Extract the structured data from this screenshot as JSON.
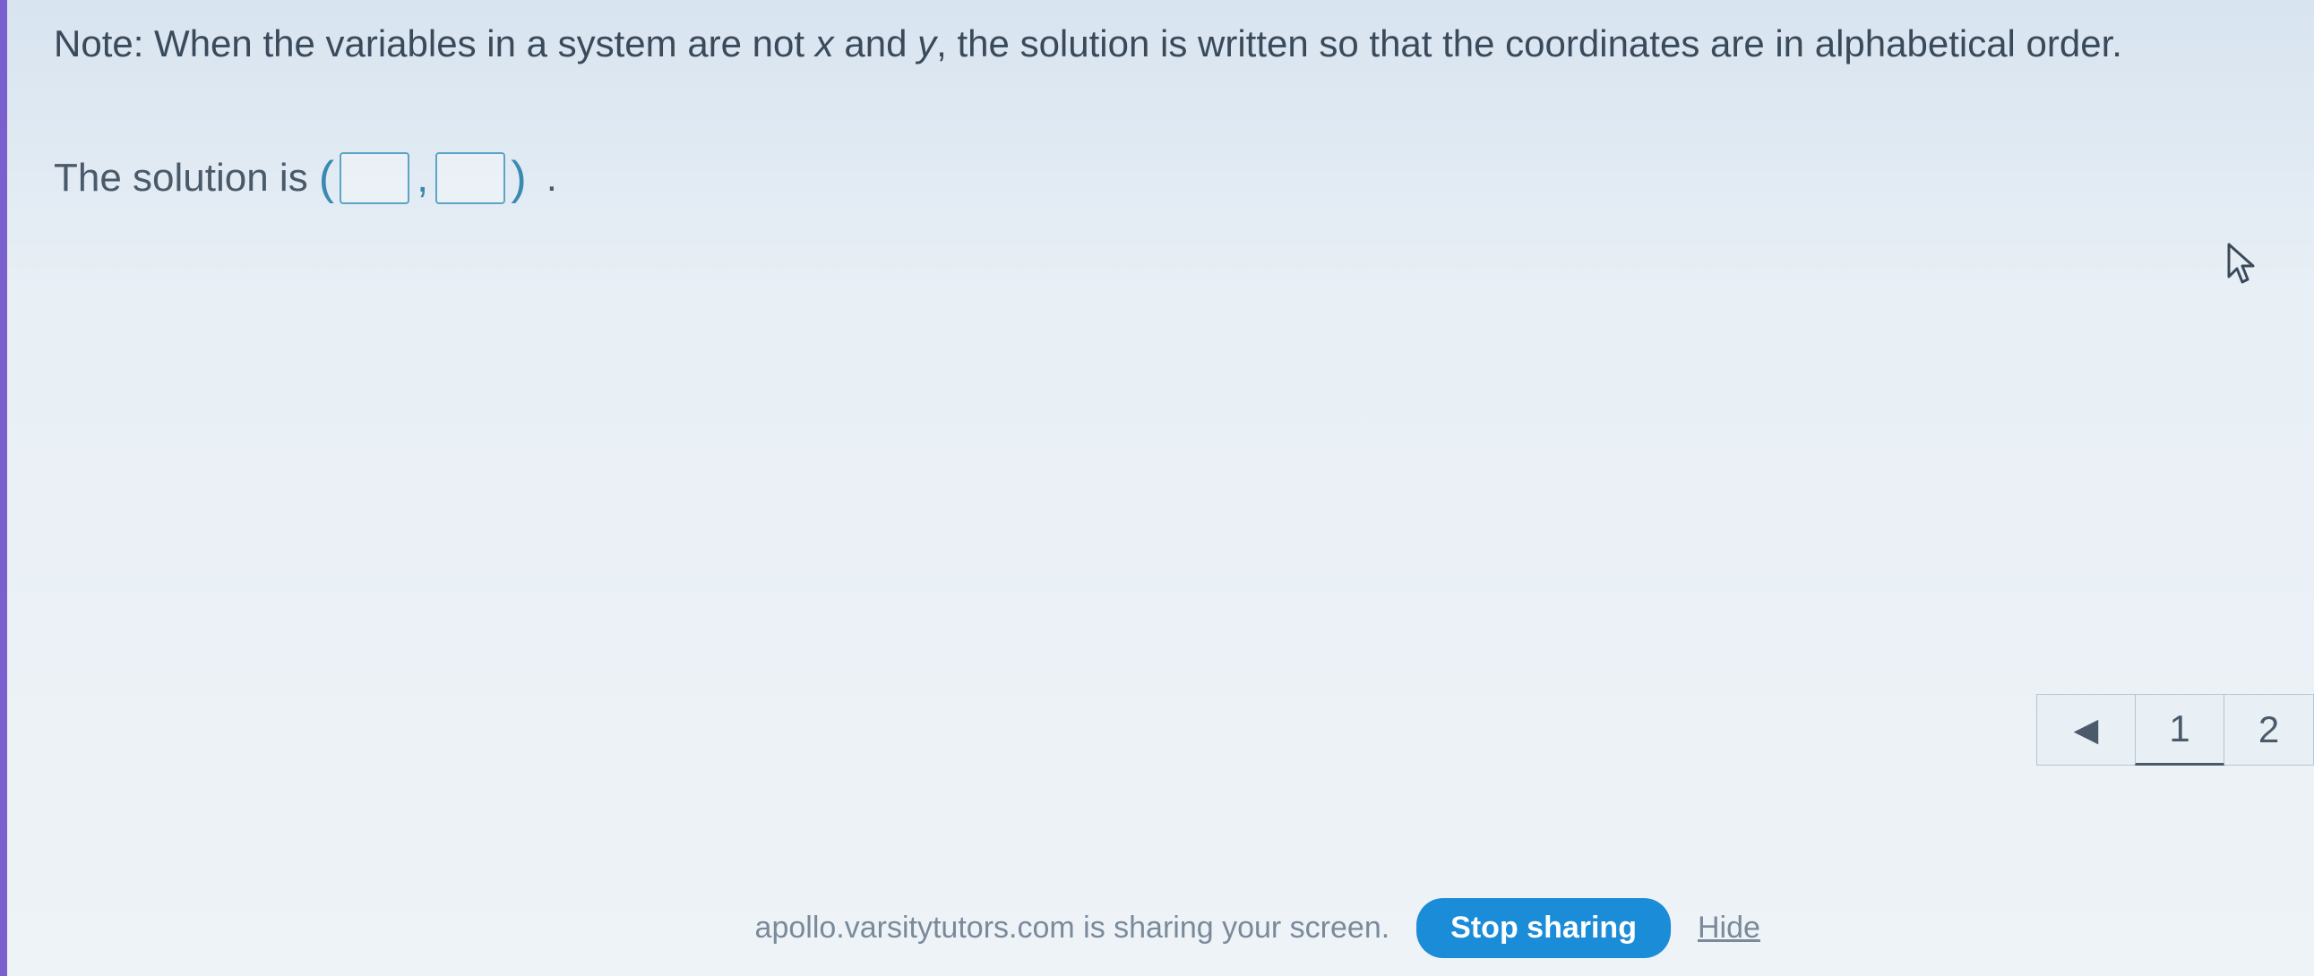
{
  "note": {
    "prefix": "Note: When the variables in a system are not ",
    "var1": "x",
    "mid": " and ",
    "var2": "y",
    "suffix": ", the solution is written so that the coordinates are in alphabetical order."
  },
  "solution": {
    "label": "The solution is",
    "open_paren": "(",
    "comma": ",",
    "close_paren": ")",
    "period": ".",
    "input1": "",
    "input2": ""
  },
  "pagination": {
    "prev_symbol": "◀",
    "page1": "1",
    "page2": "2"
  },
  "sharing": {
    "text": "apollo.varsitytutors.com is sharing your screen.",
    "stop_label": "Stop sharing",
    "hide_label": "Hide"
  }
}
